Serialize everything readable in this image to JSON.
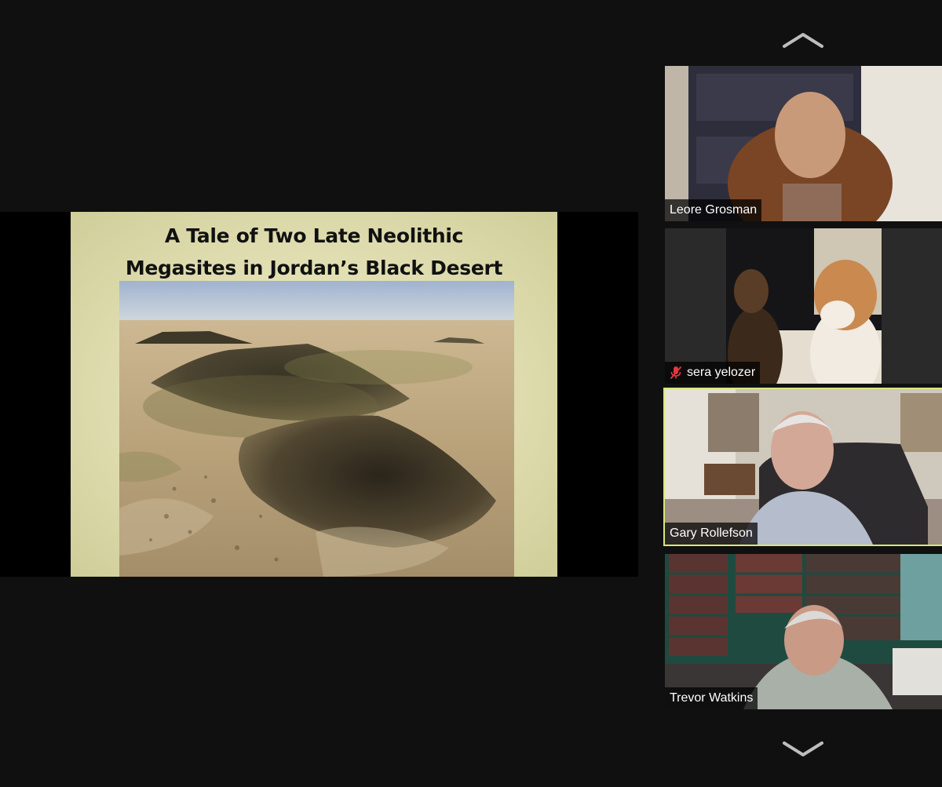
{
  "slide": {
    "title_line1": "A Tale of Two Late Neolithic",
    "title_line2": "Megasites in Jordan’s Black Desert"
  },
  "navigation": {
    "up_icon": "chevron-up-icon",
    "down_icon": "chevron-down-icon"
  },
  "participants": [
    {
      "name": "Leore Grosman",
      "muted": false,
      "active_speaker": false
    },
    {
      "name": "sera yelozer",
      "muted": true,
      "active_speaker": false
    },
    {
      "name": "Gary Rollefson",
      "muted": false,
      "active_speaker": true
    },
    {
      "name": "Trevor Watkins",
      "muted": false,
      "active_speaker": false
    }
  ],
  "colors": {
    "background": "#101010",
    "active_speaker_border": "#d6e87a",
    "muted_icon": "#e0383e",
    "slide_background": "#dedcae"
  }
}
